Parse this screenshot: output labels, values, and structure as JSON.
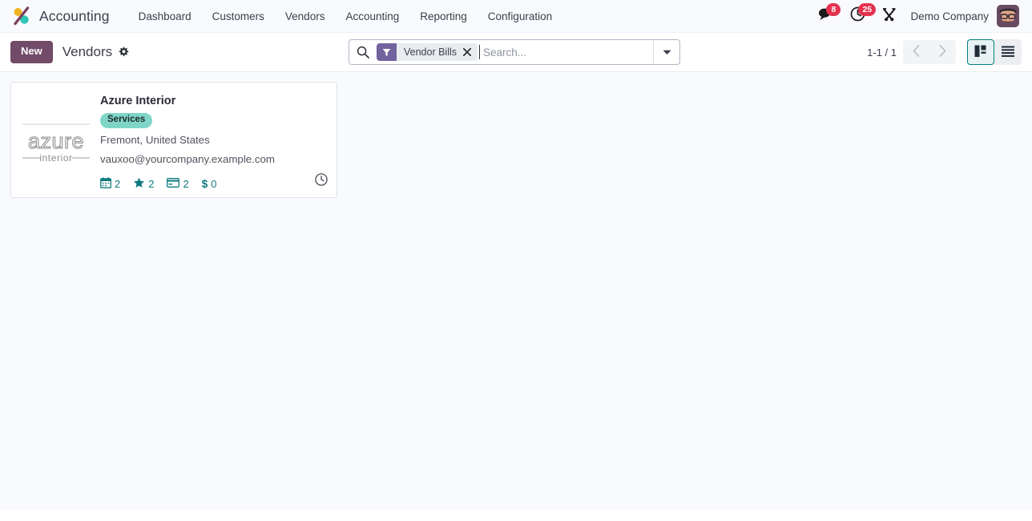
{
  "navbar": {
    "brand": "Accounting",
    "logo_icon": "odoo-logo",
    "menu": [
      {
        "label": "Dashboard"
      },
      {
        "label": "Customers"
      },
      {
        "label": "Vendors"
      },
      {
        "label": "Accounting"
      },
      {
        "label": "Reporting"
      },
      {
        "label": "Configuration"
      }
    ],
    "messages": {
      "icon": "chat-bubbles-icon",
      "count": "8"
    },
    "activities": {
      "icon": "clock-icon",
      "count": "25"
    },
    "apps_tools": {
      "icon": "wrench-tools-icon"
    },
    "company": "Demo Company",
    "avatar": {
      "icon": "user-avatar"
    }
  },
  "control_panel": {
    "new_label": "New",
    "breadcrumb": "Vendors",
    "settings_icon": "gear-icon",
    "search": {
      "icon": "search-icon",
      "facet": {
        "icon": "filter-funnel-icon",
        "label": "Vendor Bills",
        "remove_icon": "close-icon"
      },
      "placeholder": "Search...",
      "value": "",
      "dropdown_icon": "caret-down-icon"
    },
    "pager": {
      "count": "1-1 / 1",
      "prev_icon": "chevron-left-icon",
      "next_icon": "chevron-right-icon"
    },
    "views": [
      {
        "name": "kanban",
        "icon": "kanban-view-icon",
        "active": true
      },
      {
        "name": "list",
        "icon": "list-view-icon",
        "active": false
      }
    ]
  },
  "kanban": {
    "records": [
      {
        "logo_alt": "azure interior",
        "logo_text_main": "azure",
        "logo_text_sub": "interior",
        "title": "Azure Interior",
        "tag": "Services",
        "location": "Fremont, United States",
        "email": "vauxoo@yourcompany.example.com",
        "stats": [
          {
            "icon": "calendar-icon",
            "value": "2"
          },
          {
            "icon": "star-icon",
            "value": "2"
          },
          {
            "icon": "credit-card-icon",
            "value": "2"
          },
          {
            "icon": "dollar-icon",
            "value": "0"
          }
        ],
        "activity_icon": "clock-outline-icon"
      }
    ]
  },
  "colors": {
    "brand_purple": "#714b67",
    "facet_purple": "#71639e",
    "badge_red": "#e4324f",
    "teal": "#017e84",
    "tag_teal": "#7fd6c8",
    "background": "#f9fafd"
  }
}
